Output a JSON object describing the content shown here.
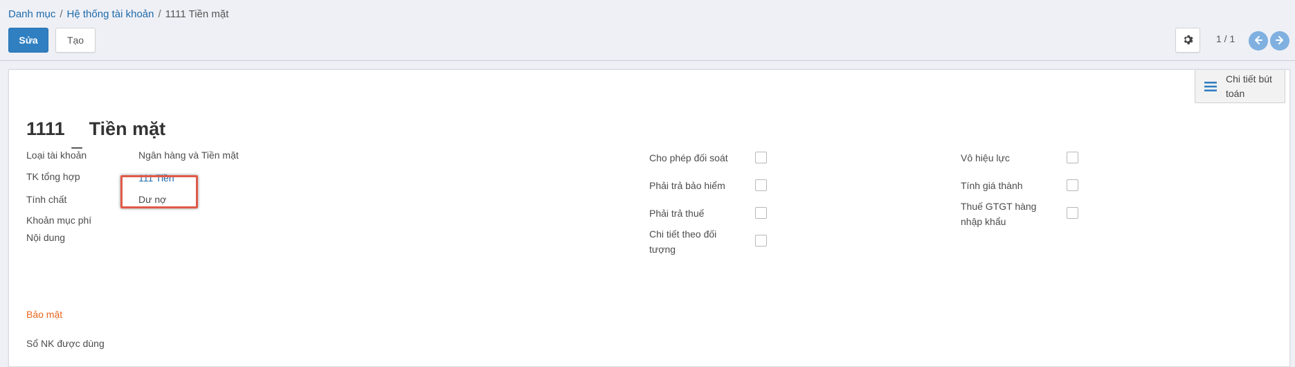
{
  "breadcrumb": {
    "items": [
      "Danh mục",
      "Hệ thống tài khoản"
    ],
    "current": "1111 Tiền mặt",
    "separator": "/"
  },
  "toolbar": {
    "edit_label": "Sửa",
    "create_label": "Tạo",
    "gear_icon": "gear-icon",
    "pager": "1 / 1"
  },
  "stat_button": {
    "icon": "list-icon",
    "label": "Chi tiết bút toán"
  },
  "record": {
    "code": "1111",
    "dash": "_",
    "name": "Tiền mặt"
  },
  "fields": {
    "account_type": {
      "label": "Loại tài khoản",
      "value": "Ngân hàng và Tiền mặt"
    },
    "parent_account": {
      "label": "TK tổng hợp",
      "value": "111 Tiền"
    },
    "nature": {
      "label": "Tính chất",
      "value": "Dư nợ"
    },
    "expense_item": {
      "label": "Khoản mục phí",
      "value": ""
    },
    "content": {
      "label": "Nội dung",
      "value": ""
    }
  },
  "checkboxes_middle": [
    {
      "label": "Cho phép đối soát",
      "checked": false
    },
    {
      "label": "Phải trả bảo hiểm",
      "checked": false
    },
    {
      "label": "Phải trả thuế",
      "checked": false
    },
    {
      "label": "Chi tiết theo đối tượng",
      "checked": false
    }
  ],
  "checkboxes_right": [
    {
      "label": "Vô hiệu lực",
      "checked": false
    },
    {
      "label": "Tính giá thành",
      "checked": false
    },
    {
      "label": "Thuế GTGT hàng nhập khẩu",
      "checked": false
    }
  ],
  "security": {
    "group_title": "Bảo mật",
    "journal_label": "Sổ NK được dùng"
  },
  "colors": {
    "primary": "#2f7fc1",
    "link": "#1f6aa8",
    "group_title": "#e8651a",
    "highlight": "#e05a48"
  }
}
